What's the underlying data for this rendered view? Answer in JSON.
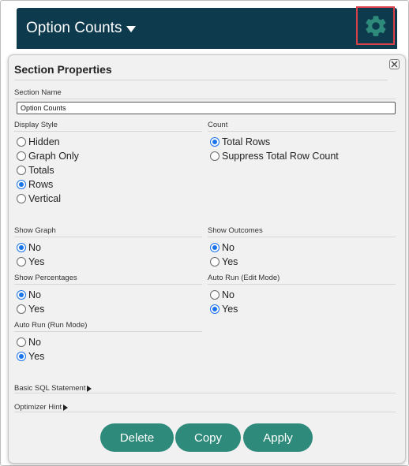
{
  "header": {
    "title": "Option Counts"
  },
  "dialog": {
    "title": "Section Properties",
    "section_name": {
      "label": "Section Name",
      "value": "Option Counts"
    },
    "display_style": {
      "label": "Display Style",
      "options": [
        "Hidden",
        "Graph Only",
        "Totals",
        "Rows",
        "Vertical"
      ],
      "selected": "Rows"
    },
    "count": {
      "label": "Count",
      "options": [
        "Total Rows",
        "Suppress Total Row Count"
      ],
      "selected": "Total Rows"
    },
    "show_graph": {
      "label": "Show Graph",
      "options": [
        "No",
        "Yes"
      ],
      "selected": "No"
    },
    "show_outcomes": {
      "label": "Show Outcomes",
      "options": [
        "No",
        "Yes"
      ],
      "selected": "No"
    },
    "show_percentages": {
      "label": "Show Percentages",
      "options": [
        "No",
        "Yes"
      ],
      "selected": "No"
    },
    "auto_run_edit": {
      "label": "Auto Run (Edit Mode)",
      "options": [
        "No",
        "Yes"
      ],
      "selected": "Yes"
    },
    "auto_run_run": {
      "label": "Auto Run (Run Mode)",
      "options": [
        "No",
        "Yes"
      ],
      "selected": "Yes"
    },
    "basic_sql": {
      "label": "Basic SQL Statement"
    },
    "optimizer_hint": {
      "label": "Optimizer Hint"
    },
    "buttons": {
      "delete": "Delete",
      "copy": "Copy",
      "apply": "Apply"
    }
  },
  "colors": {
    "header_bg": "#0e3a4e",
    "gear": "#2e8a7a",
    "highlight_border": "#d9414a",
    "button_bg": "#2e8a7a",
    "radio_selected": "#1a73e8"
  },
  "icons": {
    "gear": "gear-icon",
    "close": "close-icon",
    "caret": "caret-down-icon",
    "expand": "triangle-right-icon"
  }
}
